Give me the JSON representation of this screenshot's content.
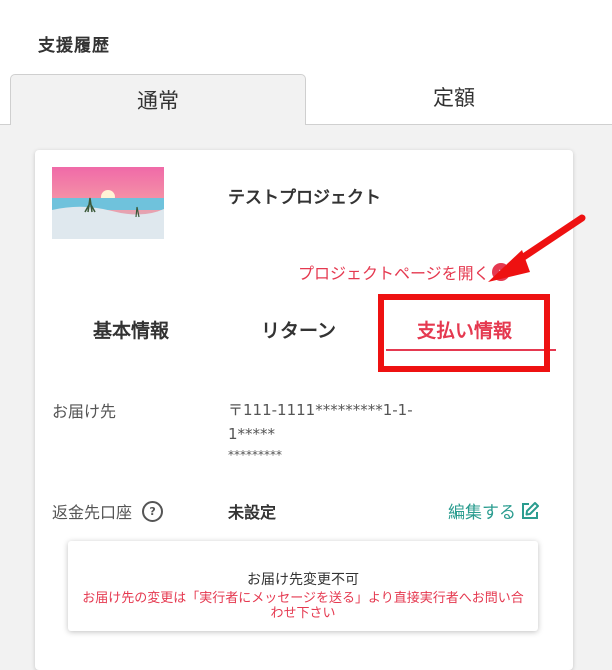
{
  "header": {
    "title": "支援履歴"
  },
  "tabs": [
    {
      "label": "通常",
      "active": true
    },
    {
      "label": "定額",
      "active": false
    }
  ],
  "project": {
    "title": "テストプロジェクト",
    "link_label": "プロジェクトページを開く"
  },
  "sub_tabs": [
    {
      "label": "基本情報",
      "active": false
    },
    {
      "label": "リターン",
      "active": false
    },
    {
      "label": "支払い情報",
      "active": true
    }
  ],
  "address": {
    "label": "お届け先",
    "value_line1": "〒111-1111*********1-1-",
    "value_line2": "1*****",
    "value_line3": "*********"
  },
  "refund": {
    "label": "返金先口座",
    "value": "未設定",
    "edit_label": "編集する"
  },
  "notice": {
    "title": "お届け先変更不可",
    "body": "お届け先の変更は「実行者にメッセージを送る」より直接実行者へお問い合わせ下さい"
  },
  "colors": {
    "accent": "#e53950",
    "link_teal": "#2a9c8f",
    "highlight": "#ee1111"
  }
}
